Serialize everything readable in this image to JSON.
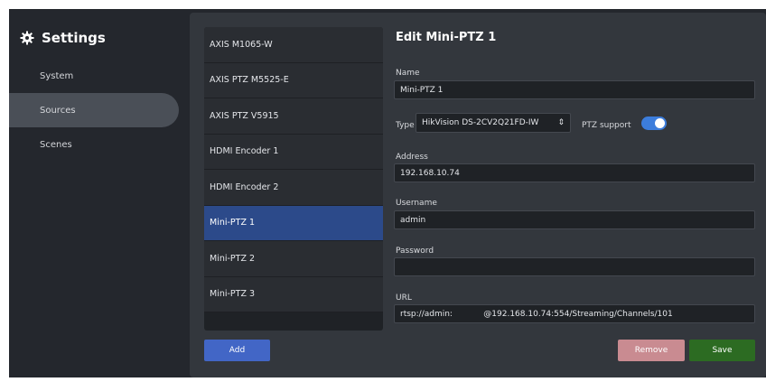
{
  "sidebar": {
    "title": "Settings",
    "items": [
      {
        "label": "System"
      },
      {
        "label": "Sources"
      },
      {
        "label": "Scenes"
      }
    ]
  },
  "sources": {
    "items": [
      {
        "label": "AXIS M1065-W"
      },
      {
        "label": "AXIS PTZ M5525-E"
      },
      {
        "label": "AXIS PTZ V5915"
      },
      {
        "label": "HDMI Encoder 1"
      },
      {
        "label": "HDMI Encoder 2"
      },
      {
        "label": "Mini-PTZ 1"
      },
      {
        "label": "Mini-PTZ 2"
      },
      {
        "label": "Mini-PTZ 3"
      }
    ],
    "add_label": "Add"
  },
  "form": {
    "title": "Edit Mini-PTZ 1",
    "name_label": "Name",
    "name_value": "Mini-PTZ 1",
    "type_label": "Type",
    "type_value": "HikVision DS-2CV2Q21FD-IW",
    "type_arrow": "⇕",
    "ptz_label": "PTZ support",
    "address_label": "Address",
    "address_value": "192.168.10.74",
    "username_label": "Username",
    "username_value": "admin",
    "password_label": "Password",
    "password_value": "",
    "url_label": "URL",
    "url_value": "rtsp://admin:            @192.168.10.74:554/Streaming/Channels/101",
    "remove_label": "Remove",
    "save_label": "Save"
  },
  "colors": {
    "accent": "#4266c6",
    "active_source": "#2c4a8a",
    "toggle_on": "#3c7ddc",
    "remove": "#c98b91",
    "save": "#2c6b22"
  }
}
